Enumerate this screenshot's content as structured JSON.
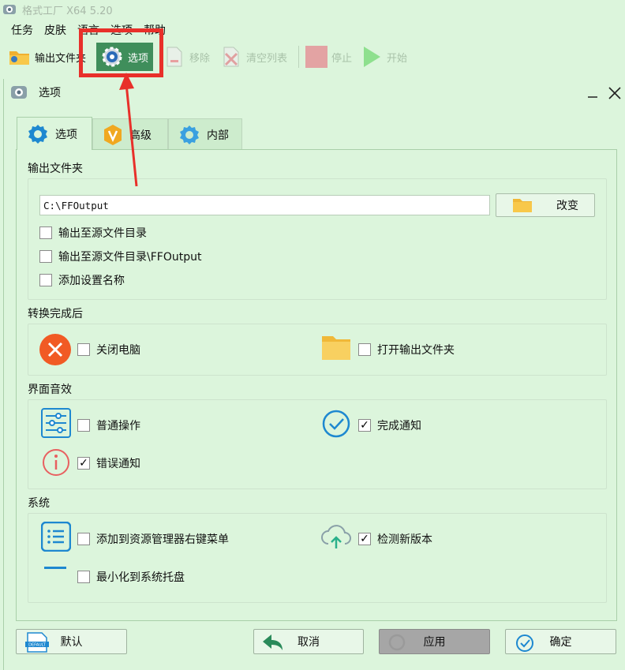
{
  "app": {
    "title": "格式工厂 X64 5.20",
    "menu": [
      "任务",
      "皮肤",
      "语言",
      "选项",
      "帮助"
    ]
  },
  "toolbar": {
    "output_folder": "输出文件夹",
    "options": "选项",
    "remove": "移除",
    "clear_list": "清空列表",
    "stop": "停止",
    "start": "开始"
  },
  "dialog": {
    "title": "选项",
    "minimize": "—",
    "close": "✕",
    "tabs": [
      {
        "label": "选项",
        "icon": "gear-icon"
      },
      {
        "label": "高级",
        "icon": "v-badge-icon"
      },
      {
        "label": "内部",
        "icon": "gear-icon"
      }
    ],
    "sections": {
      "output_folder": {
        "label": "输出文件夹",
        "path": "C:\\FFOutput",
        "change_button": "改变",
        "options": [
          {
            "label": "输出至源文件目录",
            "checked": false
          },
          {
            "label": "输出至源文件目录\\FFOutput",
            "checked": false
          },
          {
            "label": "添加设置名称",
            "checked": false
          }
        ]
      },
      "after_convert": {
        "label": "转换完成后",
        "shutdown": {
          "label": "关闭电脑",
          "checked": false
        },
        "open_folder": {
          "label": "打开输出文件夹",
          "checked": false
        }
      },
      "sound": {
        "label": "界面音效",
        "normal": {
          "label": "普通操作",
          "checked": false
        },
        "complete": {
          "label": "完成通知",
          "checked": true
        },
        "error": {
          "label": "错误通知",
          "checked": true
        }
      },
      "system": {
        "label": "系统",
        "context_menu": {
          "label": "添加到资源管理器右键菜单",
          "checked": false
        },
        "check_update": {
          "label": "检测新版本",
          "checked": true
        },
        "minimize_tray": {
          "label": "最小化到系统托盘",
          "checked": false
        }
      }
    },
    "buttons": {
      "default": "默认",
      "default_icon_text": "DEFAULT",
      "cancel": "取消",
      "apply": "应用",
      "ok": "确定"
    }
  },
  "colors": {
    "background": "#dcf5dc",
    "highlight": "#e8302a",
    "accent_blue": "#1e88d0",
    "shutdown_orange": "#f15a24",
    "folder_yellow": "#f8c84a",
    "options_button": "#3f8e5b"
  }
}
